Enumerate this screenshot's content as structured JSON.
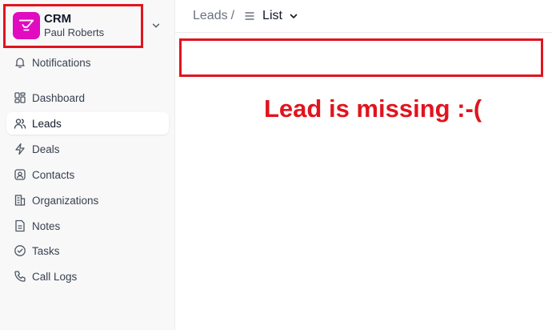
{
  "brand": {
    "title": "CRM",
    "user": "Paul Roberts",
    "logo_color": "#e10bc0"
  },
  "sidebar": {
    "notifications": {
      "label": "Notifications",
      "icon": "bell-icon"
    },
    "items": [
      {
        "label": "Dashboard",
        "icon": "dashboard-icon",
        "active": false
      },
      {
        "label": "Leads",
        "icon": "users-icon",
        "active": true
      },
      {
        "label": "Deals",
        "icon": "lightning-icon",
        "active": false
      },
      {
        "label": "Contacts",
        "icon": "contact-icon",
        "active": false
      },
      {
        "label": "Organizations",
        "icon": "building-icon",
        "active": false
      },
      {
        "label": "Notes",
        "icon": "note-icon",
        "active": false
      },
      {
        "label": "Tasks",
        "icon": "check-circle-icon",
        "active": false
      },
      {
        "label": "Call Logs",
        "icon": "phone-icon",
        "active": false
      }
    ]
  },
  "breadcrumb": {
    "root": "Leads",
    "separator": "/",
    "current": "List"
  },
  "annotation": {
    "text": "Lead is missing :-(",
    "color": "#e1141e"
  }
}
